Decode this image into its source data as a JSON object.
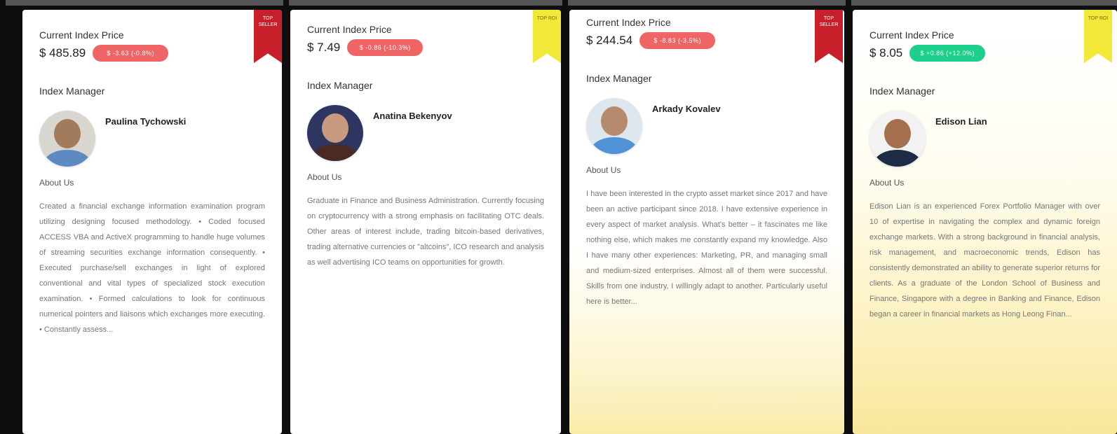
{
  "cards": [
    {
      "price_label": "Current Index Price",
      "price": "$ 485.89",
      "badge": "$ -3.63 (-0.8%)",
      "badge_color": "#ef6565",
      "ribbon": "TOP SELLER",
      "ribbon_color": "#c8202a",
      "section_title": "Index Manager",
      "manager_name": "Paulina Tychowski",
      "about_title": "About Us",
      "about_text": "Created a financial exchange information examination program utilizing designing focused methodology. • Coded focused ACCESS VBA and ActiveX programming to handle huge volumes of streaming securities exchange information consequently. • Executed purchase/sell exchanges in light of explored conventional and vital types of specialized stock execution examination. • Formed calculations to look for continuous numerical pointers and liaisons which exchanges more executing. • Constantly assess..."
    },
    {
      "price_label": "Current Index Price",
      "price": "$ 7.49",
      "badge": "$ -0.86 (-10.3%)",
      "badge_color": "#ef6565",
      "ribbon": "TOP ROI",
      "ribbon_color": "#f2e83a",
      "section_title": "Index Manager",
      "manager_name": "Anatina Bekenyov",
      "about_title": "About Us",
      "about_text": "Graduate in Finance and Business Administration. Currently focusing on cryptocurrency with a strong emphasis on facilitating OTC deals. Other areas of interest include, trading bitcoin-based derivatives, trading alternative currencies or \"altcoins\", ICO research and analysis as well advertising ICO teams on opportunities for growth."
    },
    {
      "price_label": "Current Index Price",
      "price": "$ 244.54",
      "badge": "$ -8.83 (-3.5%)",
      "badge_color": "#ef6565",
      "ribbon": "TOP SELLER",
      "ribbon_color": "#c8202a",
      "section_title": "Index Manager",
      "manager_name": "Arkady Kovalev",
      "about_title": "About Us",
      "about_text": "I have been interested in the crypto asset market since 2017 and have been an active participant since 2018. I have extensive experience in every aspect of market analysis. What's better – it fascinates me like nothing else, which makes me constantly expand my knowledge. Also I have many other experiences: Marketing, PR, and managing small and medium-sized enterprises. Almost all of them were successful. Skills from one industry, I willingly adapt to another. Particularly useful here is better..."
    },
    {
      "price_label": "Current Index Price",
      "price": "$ 8.05",
      "badge": "$ +0.86 (+12.0%)",
      "badge_color": "#1ccf8a",
      "ribbon": "TOP ROI",
      "ribbon_color": "#f2e83a",
      "section_title": "Index Manager",
      "manager_name": "Edison Lian",
      "about_title": "About Us",
      "about_text": "Edison Lian is an experienced Forex Portfolio Manager with over 10 of expertise in navigating the complex and dynamic foreign exchange markets. With a strong background in financial analysis, risk management, and macroeconomic trends, Edison has consistently demonstrated an ability to generate superior returns for clients. As a graduate of the London School of Business and Finance, Singapore with a degree in Banking and Finance, Edison began a career in financial markets as Hong Leong Finan..."
    }
  ]
}
